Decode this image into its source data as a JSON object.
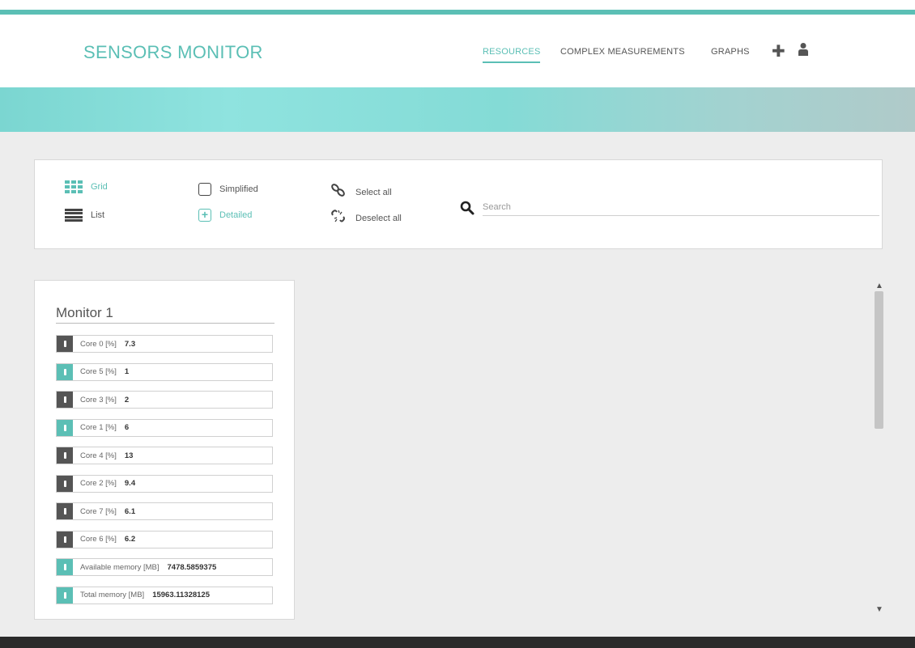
{
  "app": {
    "brand": "SENSORS MONITOR"
  },
  "nav": {
    "items": [
      {
        "label": "RESOURCES",
        "active": true
      },
      {
        "label": "COMPLEX MEASUREMENTS",
        "active": false
      },
      {
        "label": "GRAPHS",
        "active": false
      }
    ],
    "add_icon": "plus-icon",
    "user_icon": "user-icon"
  },
  "toolbar": {
    "grid_label": "Grid",
    "list_label": "List",
    "simplified_label": "Simplified",
    "detailed_label": "Detailed",
    "select_all_label": "Select all",
    "deselect_all_label": "Deselect all",
    "search_placeholder": "Search",
    "active_view": "grid",
    "active_mode": "detailed"
  },
  "monitor": {
    "title": "Monitor 1",
    "rows": [
      {
        "label": "Core 0 [%]",
        "value": "7.3",
        "icon_color": "dark"
      },
      {
        "label": "Core 5 [%]",
        "value": "1",
        "icon_color": "teal"
      },
      {
        "label": "Core 3 [%]",
        "value": "2",
        "icon_color": "dark"
      },
      {
        "label": "Core 1 [%]",
        "value": "6",
        "icon_color": "teal"
      },
      {
        "label": "Core 4 [%]",
        "value": "13",
        "icon_color": "dark"
      },
      {
        "label": "Core 2 [%]",
        "value": "9.4",
        "icon_color": "dark"
      },
      {
        "label": "Core 7 [%]",
        "value": "6.1",
        "icon_color": "dark"
      },
      {
        "label": "Core 6 [%]",
        "value": "6.2",
        "icon_color": "dark"
      },
      {
        "label": "Available memory [MB]",
        "value": "7478.5859375",
        "icon_color": "teal"
      },
      {
        "label": "Total memory [MB]",
        "value": "15963.11328125",
        "icon_color": "teal"
      }
    ]
  },
  "colors": {
    "accent": "#5bbfb5",
    "dark_icon": "#555555",
    "background": "#ededed",
    "footer": "#2b2b2b"
  }
}
